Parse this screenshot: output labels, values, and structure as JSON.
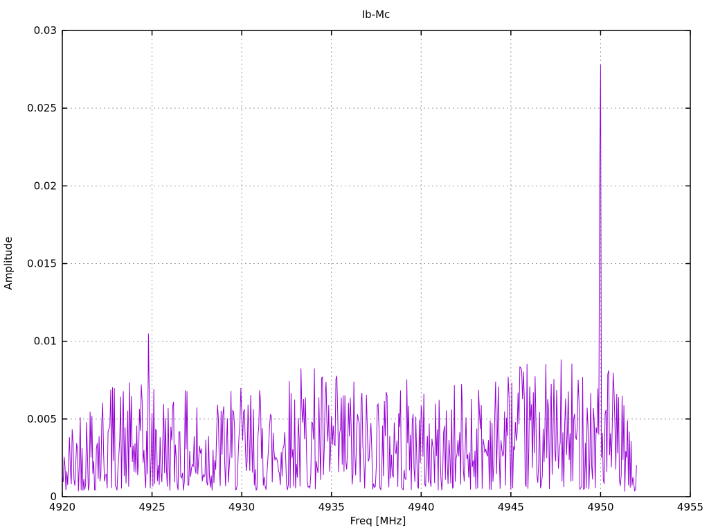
{
  "window": {
    "background": "#ffffff"
  },
  "chart_data": {
    "type": "line",
    "title": "Ib-Mc",
    "xlabel": "Freq [MHz]",
    "ylabel": "Amplitude",
    "xlim": [
      4920,
      4955
    ],
    "ylim": [
      0,
      0.03
    ],
    "xticks": {
      "values": [
        4920,
        4925,
        4930,
        4935,
        4940,
        4945,
        4950,
        4955
      ],
      "labels": [
        "4920",
        "4925",
        "4930",
        "4935",
        "4940",
        "4945",
        "4950",
        "4955"
      ]
    },
    "yticks": {
      "values": [
        0,
        0.005,
        0.01,
        0.015,
        0.02,
        0.025,
        0.03
      ],
      "labels": [
        "0",
        "0.005",
        "0.01",
        "0.015",
        "0.02",
        "0.025",
        "0.03"
      ]
    },
    "grid": true,
    "grid_color": "#9c9c9c",
    "axis_color": "#000000",
    "legend": "none",
    "series": [
      {
        "name": "Ib-Mc",
        "color": "#9400d3",
        "x_start": 4920.0,
        "x_end": 4952.0,
        "sample_step_mhz": 0.05,
        "seed": 42,
        "noise_min_factor": 0.12,
        "noise_peak_factor": 2.22,
        "noise_shape": 1.6,
        "noise_envelope": [
          [
            4920.0,
            0.0012
          ],
          [
            4920.3,
            0.002
          ],
          [
            4921.0,
            0.003
          ],
          [
            4922.5,
            0.0035
          ],
          [
            4924.0,
            0.0033
          ],
          [
            4926.0,
            0.0032
          ],
          [
            4928.0,
            0.003
          ],
          [
            4930.0,
            0.0032
          ],
          [
            4932.0,
            0.0034
          ],
          [
            4933.5,
            0.004
          ],
          [
            4935.0,
            0.0036
          ],
          [
            4937.0,
            0.0035
          ],
          [
            4939.0,
            0.0035
          ],
          [
            4941.0,
            0.003
          ],
          [
            4943.0,
            0.0036
          ],
          [
            4945.0,
            0.0038
          ],
          [
            4947.0,
            0.004
          ],
          [
            4949.0,
            0.004
          ],
          [
            4950.5,
            0.004
          ],
          [
            4951.2,
            0.003
          ],
          [
            4951.8,
            0.0015
          ],
          [
            4952.0,
            0.001
          ]
        ],
        "spikes": [
          {
            "x": 4924.82,
            "y": 0.0105
          },
          {
            "x": 4949.95,
            "y": 0.0205
          },
          {
            "x": 4950.0,
            "y": 0.0278
          }
        ]
      }
    ]
  }
}
